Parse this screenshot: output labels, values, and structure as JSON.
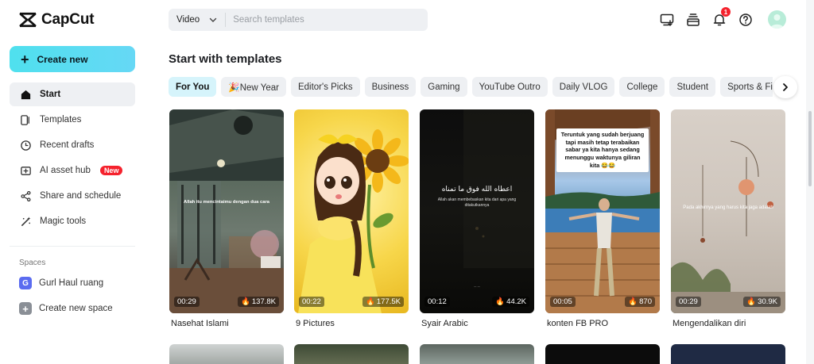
{
  "app": {
    "name": "CapCut"
  },
  "sidebar": {
    "create_label": "Create new",
    "items": [
      {
        "label": "Start",
        "icon": "home-icon",
        "active": true
      },
      {
        "label": "Templates",
        "icon": "templates-icon"
      },
      {
        "label": "Recent drafts",
        "icon": "clock-icon"
      },
      {
        "label": "AI asset hub",
        "icon": "ai-asset-icon",
        "badge": "New"
      },
      {
        "label": "Share and schedule",
        "icon": "share-icon"
      },
      {
        "label": "Magic tools",
        "icon": "magic-wand-icon"
      }
    ],
    "spaces_title": "Spaces",
    "spaces": [
      {
        "label": "Gurl Haul ruang",
        "initial": "G",
        "color": "#5b6cf0"
      },
      {
        "label": "Create new space",
        "initial": "+",
        "color": "#8a8f96"
      }
    ]
  },
  "header": {
    "search_type": "Video",
    "search_placeholder": "Search templates",
    "notification_count": "1",
    "icons": [
      "download-desktop-icon",
      "inbox-tray-icon",
      "bell-icon",
      "help-icon"
    ]
  },
  "main": {
    "section_title": "Start with templates",
    "chips": [
      "For You",
      "🎉New Year",
      "Editor's Picks",
      "Business",
      "Gaming",
      "YouTube Outro",
      "Daily VLOG",
      "College",
      "Student",
      "Sports & Fitness"
    ],
    "active_chip": "For You",
    "templates": [
      {
        "title": "Nasehat Islami",
        "duration": "00:29",
        "likes": "137.8K",
        "overlay": "Allah itu mencintaimu dengan dua cara",
        "theme": "cafe"
      },
      {
        "title": "9 Pictures",
        "duration": "00:22",
        "likes": "177.5K",
        "overlay": "",
        "theme": "sunflower"
      },
      {
        "title": "Syair Arabic",
        "duration": "00:12",
        "likes": "44.2K",
        "overlay": "Allah akan membebaskan kita dari apa yang ditakutkannya",
        "theme": "dark"
      },
      {
        "title": "konten FB PRO",
        "duration": "00:05",
        "likes": "870",
        "overlay": "Teruntuk yang sudah berjuang tapi masih tetap terabaikan sabar ya kita hanya sedang menunggu waktunya giliran kita 😂😂",
        "theme": "pier"
      },
      {
        "title": "Mengendalikan diri",
        "duration": "00:29",
        "likes": "30.9K",
        "overlay": "Pada akhirnya yang harus kita jaga adalah",
        "theme": "room"
      }
    ]
  },
  "colors": {
    "accent": "#4fe0ee",
    "badge": "#f5222d",
    "chip_active": "#d6f4fb"
  }
}
